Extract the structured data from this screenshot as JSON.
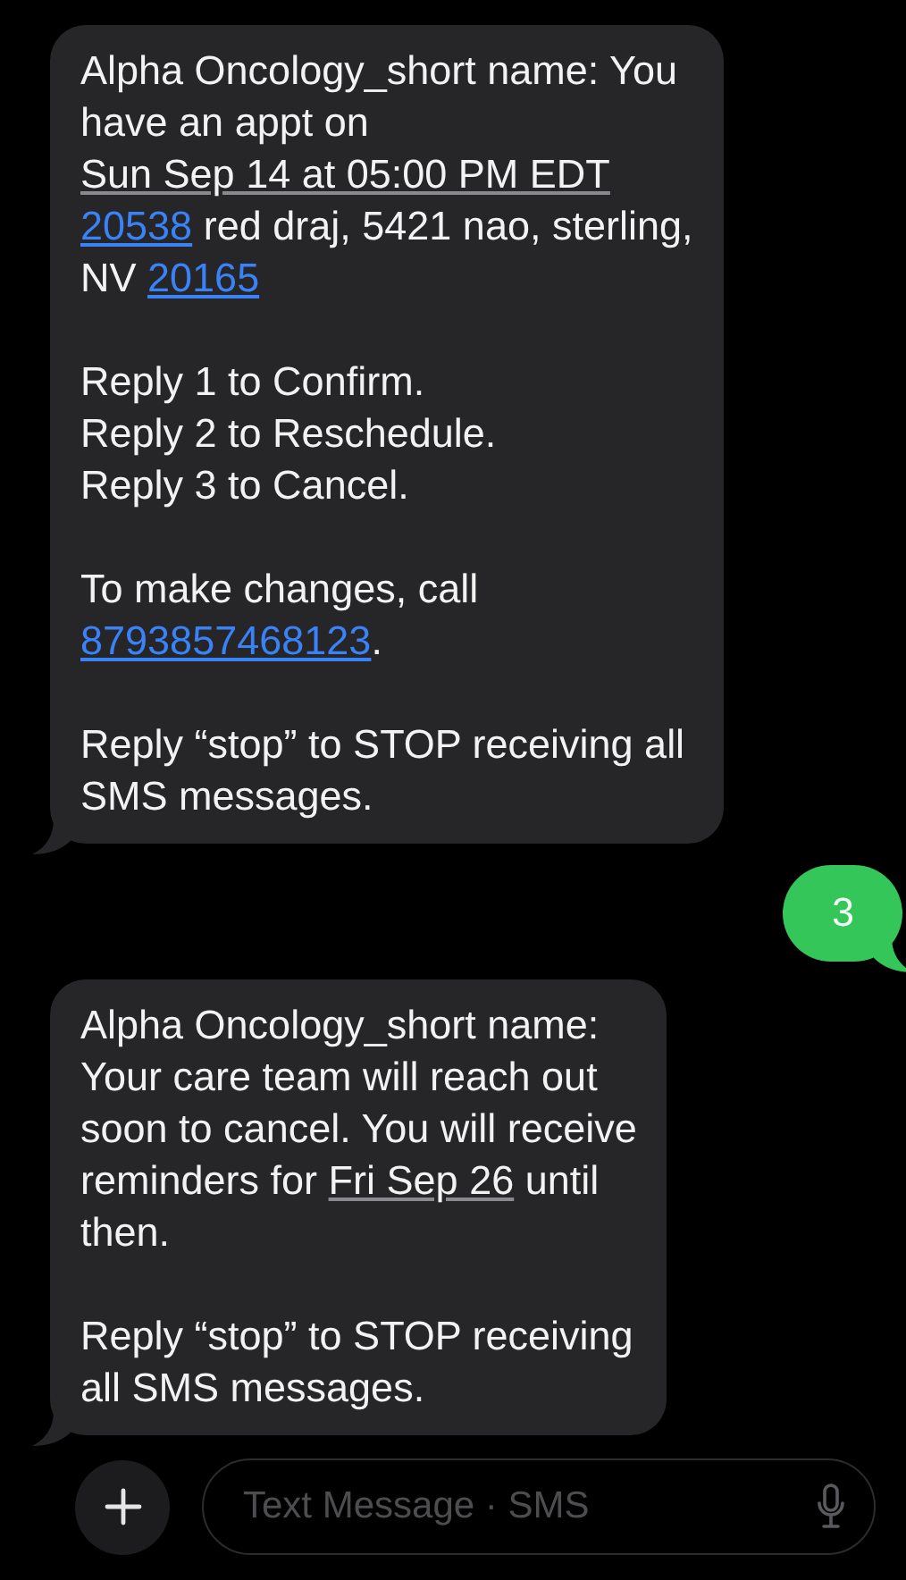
{
  "messages": [
    {
      "kind": "incoming",
      "paragraphs": [
        [
          [
            {
              "text": "Alpha Oncology_short name: You",
              "kind": "plain"
            }
          ],
          [
            {
              "text": "have an appt on",
              "kind": "plain"
            }
          ],
          [
            {
              "text": "Sun Sep 14 at 05:00 PM EDT",
              "kind": "date"
            }
          ],
          [
            {
              "text": "20538",
              "kind": "link"
            },
            {
              "text": " red draj, 5421 nao, sterling,",
              "kind": "plain"
            }
          ],
          [
            {
              "text": "NV ",
              "kind": "plain"
            },
            {
              "text": "20165",
              "kind": "link"
            }
          ]
        ],
        [
          [
            {
              "text": "Reply 1 to Confirm.",
              "kind": "plain"
            }
          ],
          [
            {
              "text": "Reply 2 to Reschedule.",
              "kind": "plain"
            }
          ],
          [
            {
              "text": "Reply 3 to Cancel.",
              "kind": "plain"
            }
          ]
        ],
        [
          [
            {
              "text": "To make changes, call",
              "kind": "plain"
            }
          ],
          [
            {
              "text": "8793857468123",
              "kind": "link"
            },
            {
              "text": ".",
              "kind": "plain"
            }
          ]
        ],
        [
          [
            {
              "text": "Reply “stop” to STOP receiving all",
              "kind": "plain"
            }
          ],
          [
            {
              "text": "SMS messages.",
              "kind": "plain"
            }
          ]
        ]
      ]
    },
    {
      "kind": "outgoing",
      "paragraphs": [
        [
          [
            {
              "text": "3",
              "kind": "plain"
            }
          ]
        ]
      ]
    },
    {
      "kind": "incoming",
      "paragraphs": [
        [
          [
            {
              "text": "Alpha Oncology_short name:",
              "kind": "plain"
            }
          ],
          [
            {
              "text": "Your care team will reach out",
              "kind": "plain"
            }
          ],
          [
            {
              "text": "soon to cancel. You will receive",
              "kind": "plain"
            }
          ],
          [
            {
              "text": "reminders for ",
              "kind": "plain"
            },
            {
              "text": "Fri Sep 26",
              "kind": "date"
            },
            {
              "text": " until",
              "kind": "plain"
            }
          ],
          [
            {
              "text": "then.",
              "kind": "plain"
            }
          ]
        ],
        [
          [
            {
              "text": "Reply “stop” to STOP receiving",
              "kind": "plain"
            }
          ],
          [
            {
              "text": "all SMS messages.",
              "kind": "plain"
            }
          ]
        ]
      ]
    }
  ],
  "composer": {
    "placeholder": "Text Message · SMS"
  }
}
